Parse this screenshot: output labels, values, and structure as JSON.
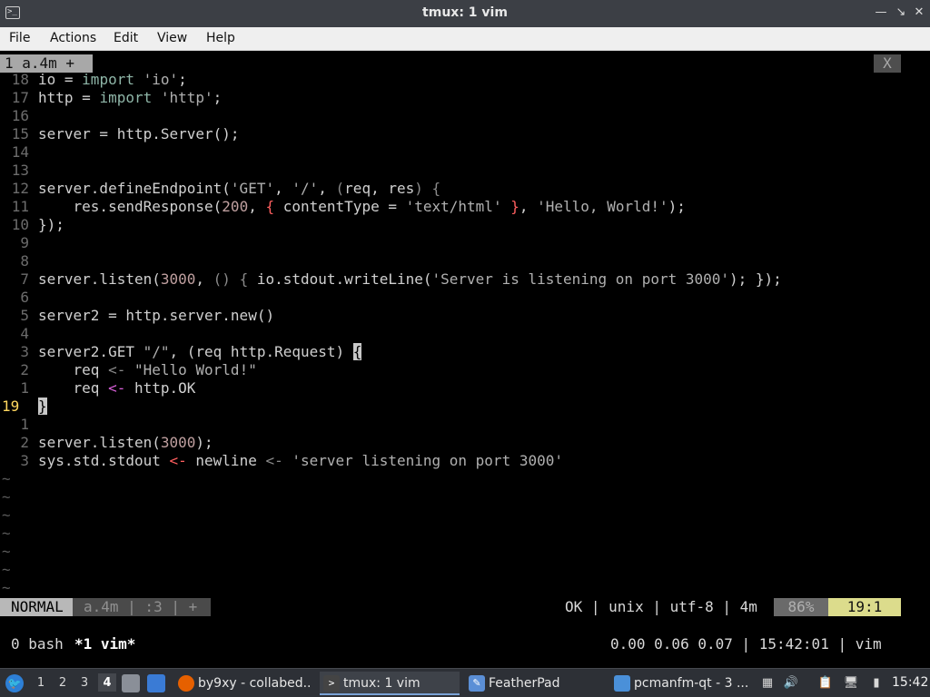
{
  "window": {
    "title": "tmux: 1 vim",
    "icon": "terminal-icon",
    "buttons": {
      "minimize": "—",
      "maximize": "↘",
      "close": "✕"
    }
  },
  "menu": [
    "File",
    "Actions",
    "Edit",
    "View",
    "Help"
  ],
  "vim": {
    "tabline": {
      "tab_label": "1 a.4m +",
      "close_label": "X"
    },
    "lines": [
      {
        "num": "18",
        "code": [
          [
            "io = ",
            "n"
          ],
          [
            "import",
            "kw"
          ],
          [
            " ",
            "n"
          ],
          [
            "'io'",
            "str"
          ],
          [
            ";",
            "n"
          ]
        ]
      },
      {
        "num": "17",
        "code": [
          [
            "http = ",
            "n"
          ],
          [
            "import",
            "kw"
          ],
          [
            " ",
            "n"
          ],
          [
            "'http'",
            "str"
          ],
          [
            ";",
            "n"
          ]
        ]
      },
      {
        "num": "16",
        "code": []
      },
      {
        "num": "15",
        "code": [
          [
            "server = http.Server();",
            "n"
          ]
        ]
      },
      {
        "num": "14",
        "code": []
      },
      {
        "num": "13",
        "code": []
      },
      {
        "num": "12",
        "code": [
          [
            "server.defineEndpoint(",
            "n"
          ],
          [
            "'GET'",
            "str"
          ],
          [
            ", ",
            "n"
          ],
          [
            "'/'",
            "str"
          ],
          [
            ", ",
            "n"
          ],
          [
            "(",
            "pun"
          ],
          [
            "req, ",
            "n"
          ],
          [
            "res",
            "n"
          ],
          [
            ") {",
            "pun"
          ]
        ]
      },
      {
        "num": "11",
        "code": [
          [
            "    res.sendResponse(",
            "n"
          ],
          [
            "200",
            "num"
          ],
          [
            ", ",
            "n"
          ],
          [
            "{",
            "red"
          ],
          [
            " contentType = ",
            "n"
          ],
          [
            "'text/html'",
            "str"
          ],
          [
            " ",
            "n"
          ],
          [
            "}",
            "red"
          ],
          [
            ", ",
            "n"
          ],
          [
            "'Hello, World!'",
            "str"
          ],
          [
            ");",
            "n"
          ]
        ]
      },
      {
        "num": "10",
        "code": [
          [
            "});",
            "n"
          ]
        ]
      },
      {
        "num": "9",
        "code": []
      },
      {
        "num": "8",
        "code": []
      },
      {
        "num": "7",
        "code": [
          [
            "server.listen(",
            "n"
          ],
          [
            "3000",
            "num"
          ],
          [
            ", ",
            "n"
          ],
          [
            "()",
            "pun"
          ],
          [
            " ",
            "n"
          ],
          [
            "{",
            "pun"
          ],
          [
            " io.stdout.writeLine(",
            "n"
          ],
          [
            "'Server is listening on port 3000'",
            "str"
          ],
          [
            ");",
            "n"
          ],
          [
            " });",
            "n"
          ]
        ]
      },
      {
        "num": "6",
        "code": []
      },
      {
        "num": "5",
        "code": [
          [
            "server2 = http.server.new()",
            "n"
          ]
        ]
      },
      {
        "num": "4",
        "code": []
      },
      {
        "num": "3",
        "code": [
          [
            "server2.GET ",
            "n"
          ],
          [
            "\"/\"",
            "str"
          ],
          [
            ", (req http.Request) ",
            "n"
          ],
          [
            "{",
            "hl"
          ]
        ]
      },
      {
        "num": "2",
        "code": [
          [
            "    req ",
            "n"
          ],
          [
            "<-",
            "pun"
          ],
          [
            " ",
            "n"
          ],
          [
            "\"Hello World!\"",
            "str"
          ]
        ]
      },
      {
        "num": "1",
        "code": [
          [
            "    req ",
            "n"
          ],
          [
            "<-",
            "magenta"
          ],
          [
            " http.OK",
            "n"
          ]
        ]
      },
      {
        "num": "19",
        "current": true,
        "code": [
          [
            "}",
            "hl"
          ]
        ]
      },
      {
        "num": "1",
        "code": []
      },
      {
        "num": "2",
        "code": [
          [
            "server.listen(",
            "n"
          ],
          [
            "3000",
            "num"
          ],
          [
            ");",
            "n"
          ]
        ]
      },
      {
        "num": "3",
        "code": [
          [
            "sys.std.stdout ",
            "n"
          ],
          [
            "<-",
            "red"
          ],
          [
            " newline ",
            "n"
          ],
          [
            "<-",
            "pun"
          ],
          [
            " ",
            "n"
          ],
          [
            "'server listening on port 3000'",
            "str"
          ]
        ]
      }
    ],
    "tildes": [
      "~",
      "~",
      "~",
      "~",
      "~",
      "~",
      "~"
    ],
    "statusline": {
      "mode": "NORMAL",
      "info": "a.4m | :3 | +",
      "right": "OK | unix | utf-8 | 4m",
      "percent": "86%",
      "position": "19:1"
    }
  },
  "tmux": {
    "window0": "0 bash",
    "window1": "*1 vim*",
    "status": "0.00 0.06 0.07 | 15:42:01 | vim"
  },
  "taskbar": {
    "desktops": [
      "1",
      "2",
      "3",
      "4"
    ],
    "active_desktop": "4",
    "tasks": [
      {
        "label": "by9xy - collabed...",
        "icon": "firefox-icon"
      },
      {
        "label": "tmux: 1 vim",
        "icon": "terminal-icon",
        "active": true
      },
      {
        "label": "FeatherPad",
        "icon": "featherpad-icon"
      },
      {
        "label": "pcmanfm-qt - 3 ...",
        "icon": "folder-icon"
      }
    ],
    "clock": "15:42"
  },
  "colors": {
    "titlebar": "#3c3f45",
    "menubar": "#efefef",
    "terminal_bg": "#000000",
    "statusline_mode": "#b8b8b8",
    "position_bg": "#dcdc8c",
    "taskbar": "#2d3036"
  }
}
